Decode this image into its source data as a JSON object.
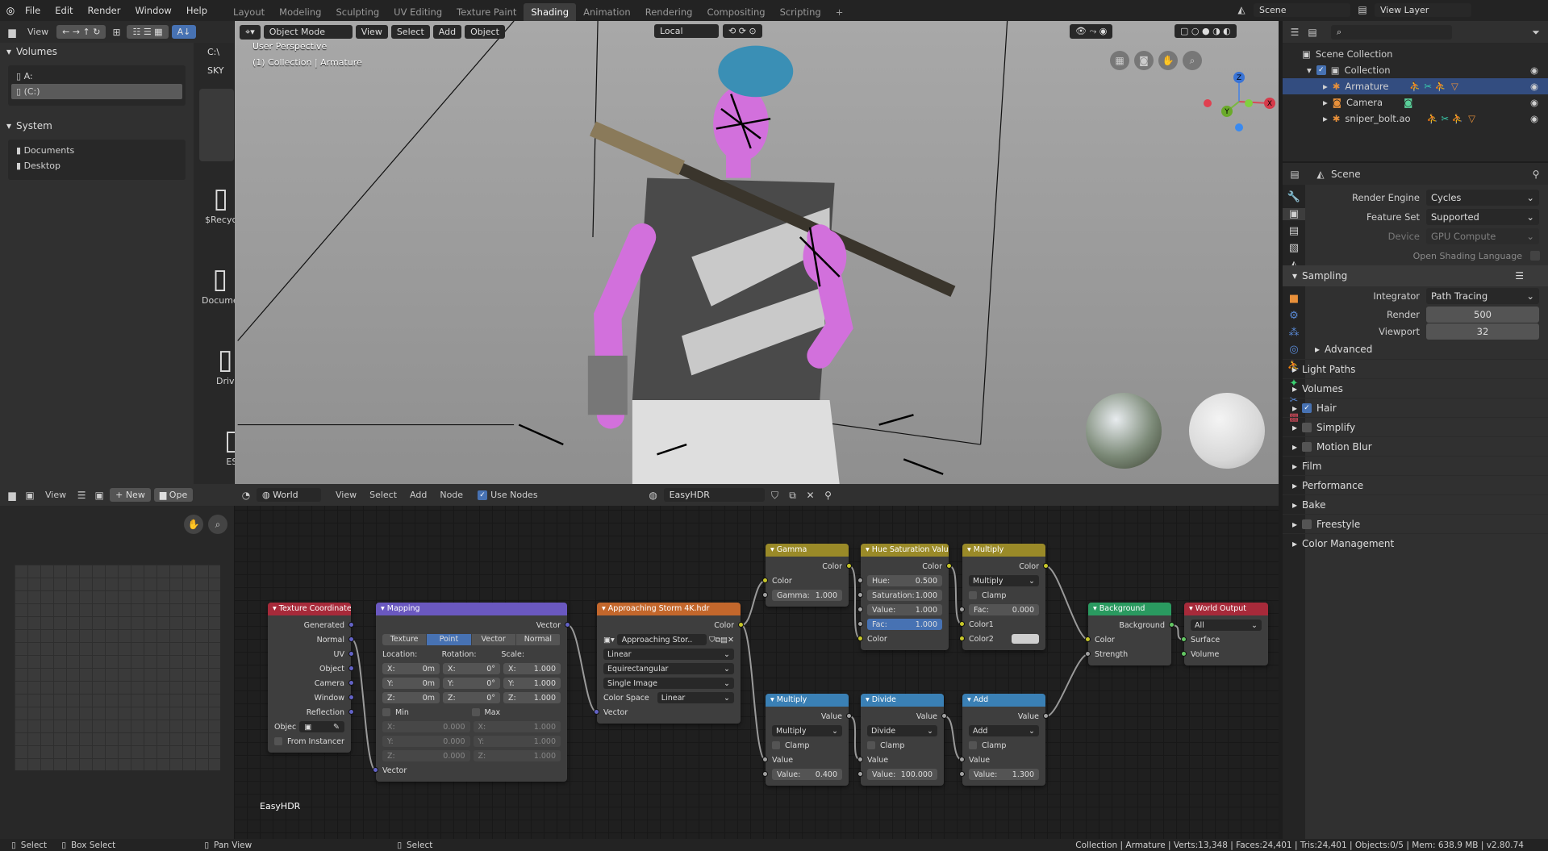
{
  "topbar": {
    "menus": [
      "File",
      "Edit",
      "Render",
      "Window",
      "Help"
    ],
    "workspaces": [
      "Layout",
      "Modeling",
      "Sculpting",
      "UV Editing",
      "Texture Paint",
      "Shading",
      "Animation",
      "Rendering",
      "Compositing",
      "Scripting"
    ],
    "active_workspace": "Shading",
    "add_tab": "+",
    "scene": "Scene",
    "view_layer": "View Layer"
  },
  "filebrowser": {
    "view": "View",
    "volumes_title": "Volumes",
    "volumes": [
      "A:",
      "(C:)"
    ],
    "system_title": "System",
    "system": [
      "Documents",
      "Desktop"
    ],
    "path_buttons": [
      "C:\\",
      "SKY"
    ],
    "files": [
      "$Recyc",
      "Docume",
      "Driv",
      "ES"
    ]
  },
  "viewport": {
    "mode": "Object Mode",
    "menus": [
      "View",
      "Select",
      "Add",
      "Object"
    ],
    "orientation": "Local",
    "overlay_line1": "User Perspective",
    "overlay_line2": "(1) Collection | Armature",
    "axes": {
      "x": "X",
      "y": "Y",
      "z": "Z"
    }
  },
  "outliner": {
    "root": "Scene Collection",
    "collection": "Collection",
    "items": [
      "Armature",
      "Camera",
      "sniper_bolt.ao"
    ],
    "selected": "Armature"
  },
  "properties": {
    "context": "Scene",
    "render_engine_label": "Render Engine",
    "render_engine": "Cycles",
    "feature_set_label": "Feature Set",
    "feature_set": "Supported",
    "device_label": "Device",
    "device": "GPU Compute",
    "osl_label": "Open Shading Language",
    "sampling": "Sampling",
    "integrator_label": "Integrator",
    "integrator": "Path Tracing",
    "render_label": "Render",
    "render": "500",
    "viewport_label": "Viewport",
    "viewport": "32",
    "advanced": "Advanced",
    "panels": [
      {
        "label": "Light Paths",
        "check": null
      },
      {
        "label": "Volumes",
        "check": null
      },
      {
        "label": "Hair",
        "check": true
      },
      {
        "label": "Simplify",
        "check": false
      },
      {
        "label": "Motion Blur",
        "check": false
      },
      {
        "label": "Film",
        "check": null
      },
      {
        "label": "Performance",
        "check": null
      },
      {
        "label": "Bake",
        "check": null
      },
      {
        "label": "Freestyle",
        "check": false
      },
      {
        "label": "Color Management",
        "check": null
      }
    ]
  },
  "image_editor": {
    "view": "View",
    "new": "New",
    "open": "Ope"
  },
  "node_editor": {
    "shader_type": "World",
    "menus": [
      "View",
      "Select",
      "Add",
      "Node"
    ],
    "use_nodes": "Use Nodes",
    "world_name": "EasyHDR",
    "tree_label": "EasyHDR"
  },
  "colors": {
    "accent": "#4772b3",
    "vector_socket": "#6363c7",
    "color_socket": "#c7c729",
    "float_socket": "#a1a1a1",
    "shader_socket": "#63c763"
  },
  "nodes": [
    {
      "title": "Texture Coordinate",
      "color": "#a72a3a",
      "rows": [
        {
          "t": "out",
          "l": "Generated",
          "s": "vec"
        },
        {
          "t": "out",
          "l": "Normal",
          "s": "vec"
        },
        {
          "t": "out",
          "l": "UV",
          "s": "vec"
        },
        {
          "t": "out",
          "l": "Object",
          "s": "vec"
        },
        {
          "t": "out",
          "l": "Camera",
          "s": "vec"
        },
        {
          "t": "out",
          "l": "Window",
          "s": "vec"
        },
        {
          "t": "out",
          "l": "Reflection",
          "s": "vec"
        },
        {
          "t": "objfield",
          "l": "Objec"
        },
        {
          "t": "check",
          "l": "From Instancer"
        }
      ]
    },
    {
      "title": "Mapping",
      "color": "#6a58c0",
      "rows": [
        {
          "t": "out",
          "l": "Vector",
          "s": "vec"
        },
        {
          "t": "tabs",
          "opts": [
            "Texture",
            "Point",
            "Vector",
            "Normal"
          ],
          "active": "Point"
        },
        {
          "t": "cols",
          "heads": [
            "Location:",
            "Rotation:",
            "Scale:"
          ]
        },
        {
          "t": "xyz",
          "vals": [
            [
              "X:",
              "0m"
            ],
            [
              "X:",
              "0°"
            ],
            [
              "X:",
              "1.000"
            ]
          ]
        },
        {
          "t": "xyz",
          "vals": [
            [
              "Y:",
              "0m"
            ],
            [
              "Y:",
              "0°"
            ],
            [
              "Y:",
              "1.000"
            ]
          ]
        },
        {
          "t": "xyz",
          "vals": [
            [
              "Z:",
              "0m"
            ],
            [
              "Z:",
              "0°"
            ],
            [
              "Z:",
              "1.000"
            ]
          ]
        },
        {
          "t": "minmax",
          "l": [
            "Min",
            "Max"
          ]
        },
        {
          "t": "xy2",
          "vals": [
            [
              "X:",
              "0.000"
            ],
            [
              "X:",
              "1.000"
            ]
          ]
        },
        {
          "t": "xy2",
          "vals": [
            [
              "Y:",
              "0.000"
            ],
            [
              "Y:",
              "1.000"
            ]
          ]
        },
        {
          "t": "xy2",
          "vals": [
            [
              "Z:",
              "0.000"
            ],
            [
              "Z:",
              "1.000"
            ]
          ]
        },
        {
          "t": "in",
          "l": "Vector",
          "s": "vec"
        }
      ]
    },
    {
      "title": "Approaching Storm 4K.hdr",
      "color": "#c3672c",
      "rows": [
        {
          "t": "out",
          "l": "Color",
          "s": "col"
        },
        {
          "t": "image",
          "l": "Approaching Stor.."
        },
        {
          "t": "select",
          "v": "Linear"
        },
        {
          "t": "select",
          "v": "Equirectangular"
        },
        {
          "t": "select",
          "v": "Single Image"
        },
        {
          "t": "lselect",
          "l": "Color Space",
          "v": "Linear"
        },
        {
          "t": "in",
          "l": "Vector",
          "s": "vec"
        }
      ]
    },
    {
      "title": "Gamma",
      "color": "#9a8a28",
      "rows": [
        {
          "t": "out",
          "l": "Color",
          "s": "col"
        },
        {
          "t": "in",
          "l": "Color",
          "s": "col"
        },
        {
          "t": "field",
          "l": "Gamma:",
          "v": "1.000",
          "s": "float"
        }
      ]
    },
    {
      "title": "Hue Saturation Value",
      "color": "#9a8a28",
      "rows": [
        {
          "t": "out",
          "l": "Color",
          "s": "col"
        },
        {
          "t": "field",
          "l": "Hue:",
          "v": "0.500",
          "s": "float"
        },
        {
          "t": "field",
          "l": "Saturation:",
          "v": "1.000",
          "s": "float"
        },
        {
          "t": "field",
          "l": "Value:",
          "v": "1.000",
          "s": "float"
        },
        {
          "t": "field",
          "l": "Fac:",
          "v": "1.000",
          "s": "float",
          "hl": true
        },
        {
          "t": "in",
          "l": "Color",
          "s": "col"
        }
      ]
    },
    {
      "title": "Multiply",
      "color": "#9a8a28",
      "rows": [
        {
          "t": "out",
          "l": "Color",
          "s": "col"
        },
        {
          "t": "select",
          "v": "Multiply"
        },
        {
          "t": "check",
          "l": "Clamp"
        },
        {
          "t": "field",
          "l": "Fac:",
          "v": "0.000",
          "s": "float"
        },
        {
          "t": "in",
          "l": "Color1",
          "s": "col"
        },
        {
          "t": "swatch",
          "l": "Color2",
          "s": "col"
        }
      ]
    },
    {
      "title": "Background",
      "color": "#2a9a60",
      "rows": [
        {
          "t": "out",
          "l": "Background",
          "s": "shader"
        },
        {
          "t": "in",
          "l": "Color",
          "s": "col"
        },
        {
          "t": "in",
          "l": "Strength",
          "s": "float"
        }
      ]
    },
    {
      "title": "World Output",
      "color": "#a72a3a",
      "rows": [
        {
          "t": "select",
          "v": "All"
        },
        {
          "t": "in",
          "l": "Surface",
          "s": "shader"
        },
        {
          "t": "in",
          "l": "Volume",
          "s": "shader"
        }
      ]
    },
    {
      "title": "Multiply",
      "color": "#3a80b5",
      "rows": [
        {
          "t": "out",
          "l": "Value",
          "s": "float"
        },
        {
          "t": "select",
          "v": "Multiply"
        },
        {
          "t": "check",
          "l": "Clamp"
        },
        {
          "t": "in",
          "l": "Value",
          "s": "float"
        },
        {
          "t": "field",
          "l": "Value:",
          "v": "0.400",
          "s": "float"
        }
      ]
    },
    {
      "title": "Divide",
      "color": "#3a80b5",
      "rows": [
        {
          "t": "out",
          "l": "Value",
          "s": "float"
        },
        {
          "t": "select",
          "v": "Divide"
        },
        {
          "t": "check",
          "l": "Clamp"
        },
        {
          "t": "in",
          "l": "Value",
          "s": "float"
        },
        {
          "t": "field",
          "l": "Value:",
          "v": "100.000",
          "s": "float"
        }
      ]
    },
    {
      "title": "Add",
      "color": "#3a80b5",
      "rows": [
        {
          "t": "out",
          "l": "Value",
          "s": "float"
        },
        {
          "t": "select",
          "v": "Add"
        },
        {
          "t": "check",
          "l": "Clamp"
        },
        {
          "t": "in",
          "l": "Value",
          "s": "float"
        },
        {
          "t": "field",
          "l": "Value:",
          "v": "1.300",
          "s": "float"
        }
      ]
    }
  ],
  "links": [
    [
      0,
      1,
      1,
      10
    ],
    [
      1,
      0,
      2,
      6
    ],
    [
      2,
      0,
      3,
      1
    ],
    [
      2,
      0,
      8,
      3
    ],
    [
      3,
      0,
      4,
      5
    ],
    [
      4,
      0,
      5,
      4
    ],
    [
      5,
      0,
      6,
      1
    ],
    [
      8,
      0,
      9,
      3
    ],
    [
      9,
      0,
      10,
      3
    ],
    [
      10,
      0,
      6,
      2
    ],
    [
      6,
      0,
      7,
      1
    ]
  ],
  "statusbar": {
    "left": [
      "Select",
      "Box Select",
      "Pan View",
      "Select"
    ],
    "stats": "Collection | Armature | Verts:13,348 | Faces:24,401 | Tris:24,401 | Objects:0/5 | Mem: 638.9 MB | v2.80.74"
  }
}
